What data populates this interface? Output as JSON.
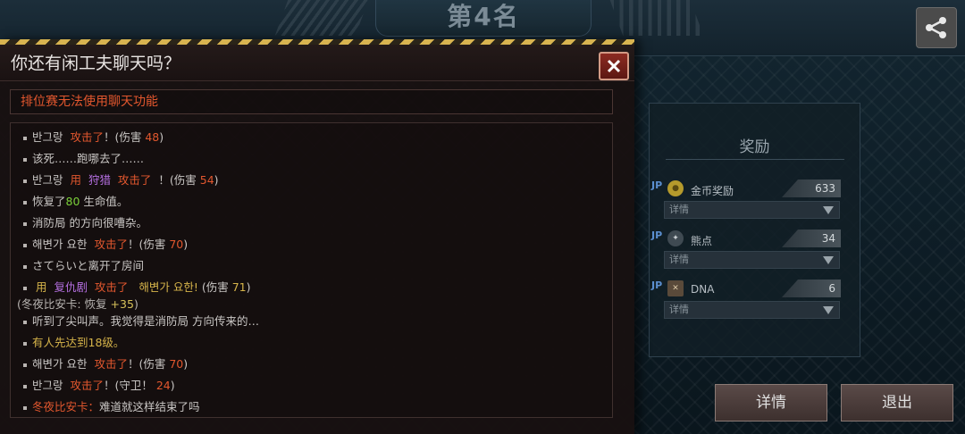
{
  "header": {
    "rank_title": "第4名"
  },
  "chat": {
    "title": "你还有闲工夫聊天吗？",
    "notice": "排位赛无法使用聊天功能",
    "lines": [
      {
        "p1": "반그랑",
        "p2": "攻击了",
        "p3": "！(伤害",
        "p4": "48",
        "p5": ")"
      },
      {
        "text": "该死……跑哪去了……"
      },
      {
        "p1": "반그랑",
        "p2": "用",
        "p3": "狩猎",
        "p4": "攻击了",
        "p5": "！(伤害",
        "p6": "54",
        "p7": ")"
      },
      {
        "p1": "恢复了",
        "p2": "80",
        "p3": "生命值。"
      },
      {
        "text": "消防局 的方向很嘈杂。"
      },
      {
        "p1": "해변가 요한",
        "p2": "攻击了",
        "p3": "！(伤害",
        "p4": "70",
        "p5": ")"
      },
      {
        "text": "さてらいと离开了房间"
      },
      {
        "p1": "用",
        "p2": "复仇剧",
        "p3": "攻击了",
        "p4": "해변가 요한!",
        "p5": "(伤害",
        "p6": "71",
        "p7": ")",
        "sub": "(冬夜比安卡: 恢复",
        "sub_val": "+35",
        "sub_end": ")"
      },
      {
        "text": "听到了尖叫声。我觉得是消防局 方向传来的…"
      },
      {
        "text": "有人先达到18级。"
      },
      {
        "p1": "해변가 요한",
        "p2": "攻击了",
        "p3": "！(伤害",
        "p4": "70",
        "p5": ")"
      },
      {
        "p1": "반그랑",
        "p2": "攻击了",
        "p3": "！(守卫！",
        "p4": "24",
        "p5": ")"
      },
      {
        "p1": "冬夜比安卡：",
        "p2": "难道就这样结束了吗"
      }
    ]
  },
  "rewards": {
    "title": "奖励",
    "items": [
      {
        "badge": "JP",
        "name": "金币奖励",
        "value": "633",
        "detail": "详情"
      },
      {
        "badge": "JP",
        "name": "熊点",
        "value": "34",
        "detail": "详情"
      },
      {
        "badge": "JP",
        "name": "DNA",
        "value": "6",
        "detail": "详情"
      }
    ]
  },
  "buttons": {
    "details": "详情",
    "exit": "退出"
  },
  "colors": {
    "accent_red": "#e2572e",
    "skill_purple": "#b46fe0",
    "heal_green": "#7bd03a",
    "system_gold": "#d6b44a"
  }
}
